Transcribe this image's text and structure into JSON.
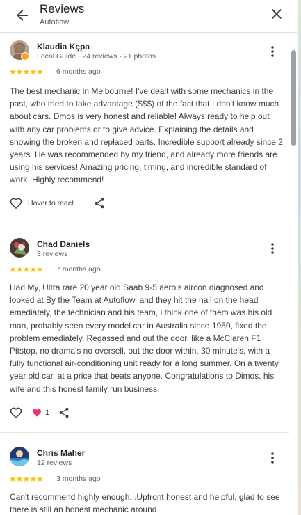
{
  "header": {
    "title": "Reviews",
    "subtitle": "Autoflow"
  },
  "reviews": [
    {
      "name": "Klaudia Kępa",
      "meta": "Local Guide · 24 reviews · 21 photos",
      "stars": "★★★★★",
      "rating": 5,
      "time": "6 months ago",
      "text": "The best mechanic in Melbourne! I've dealt with some mechanics in the past, who tried to take advantage ($$$) of the fact that I don't know much about cars. Dmos is very honest and reliable! Always ready to help out with any car problems or to give advice. Explaining the details and showing the broken and replaced parts. Incredible support already since 2 years. He was recommended by my friend, and already more friends are using his services! Amazing pricing, timing, and incredible standard of work. Highly recommend!",
      "react_label": "Hover to react"
    },
    {
      "name": "Chad Daniels",
      "meta": "3 reviews",
      "stars": "★★★★★",
      "rating": 5,
      "time": "7 months ago",
      "text": "Had My, Ultra rare 20 year old Saab 9-5 aero's aircon diagnosed and looked at By the Team at Autoflow, and they hit the nail on the head emediately, the technician and his team, i think one of them was his old man, probably seen every model car in Australia since 1950, fixed the problem emediately, Regassed and out the door, like a McClaren F1 Pitstop. no drama's no oversell, out the door within, 30 minute's, with a fully functional air-conditioning unit ready for a long summer. On a twenty year old car, at a price that beats anyone. Congratulations to Dimos, his wife and this honest family run business.",
      "like_count": "1"
    },
    {
      "name": "Chris Maher",
      "meta": "12 reviews",
      "stars": "★★★★★",
      "rating": 5,
      "time": "3 months ago",
      "text": "Can't recommend highly enough...Upfront honest and helpful, glad to see there is still an honest mechanic around."
    }
  ],
  "colors": {
    "star": "#fbbc04",
    "heart_filled": "#e8336e",
    "local_guide_badge": "#f4a51c"
  },
  "icons": [
    "back-arrow-icon",
    "close-icon",
    "more-vert-icon",
    "heart-outline-icon",
    "heart-filled-icon",
    "share-icon"
  ]
}
